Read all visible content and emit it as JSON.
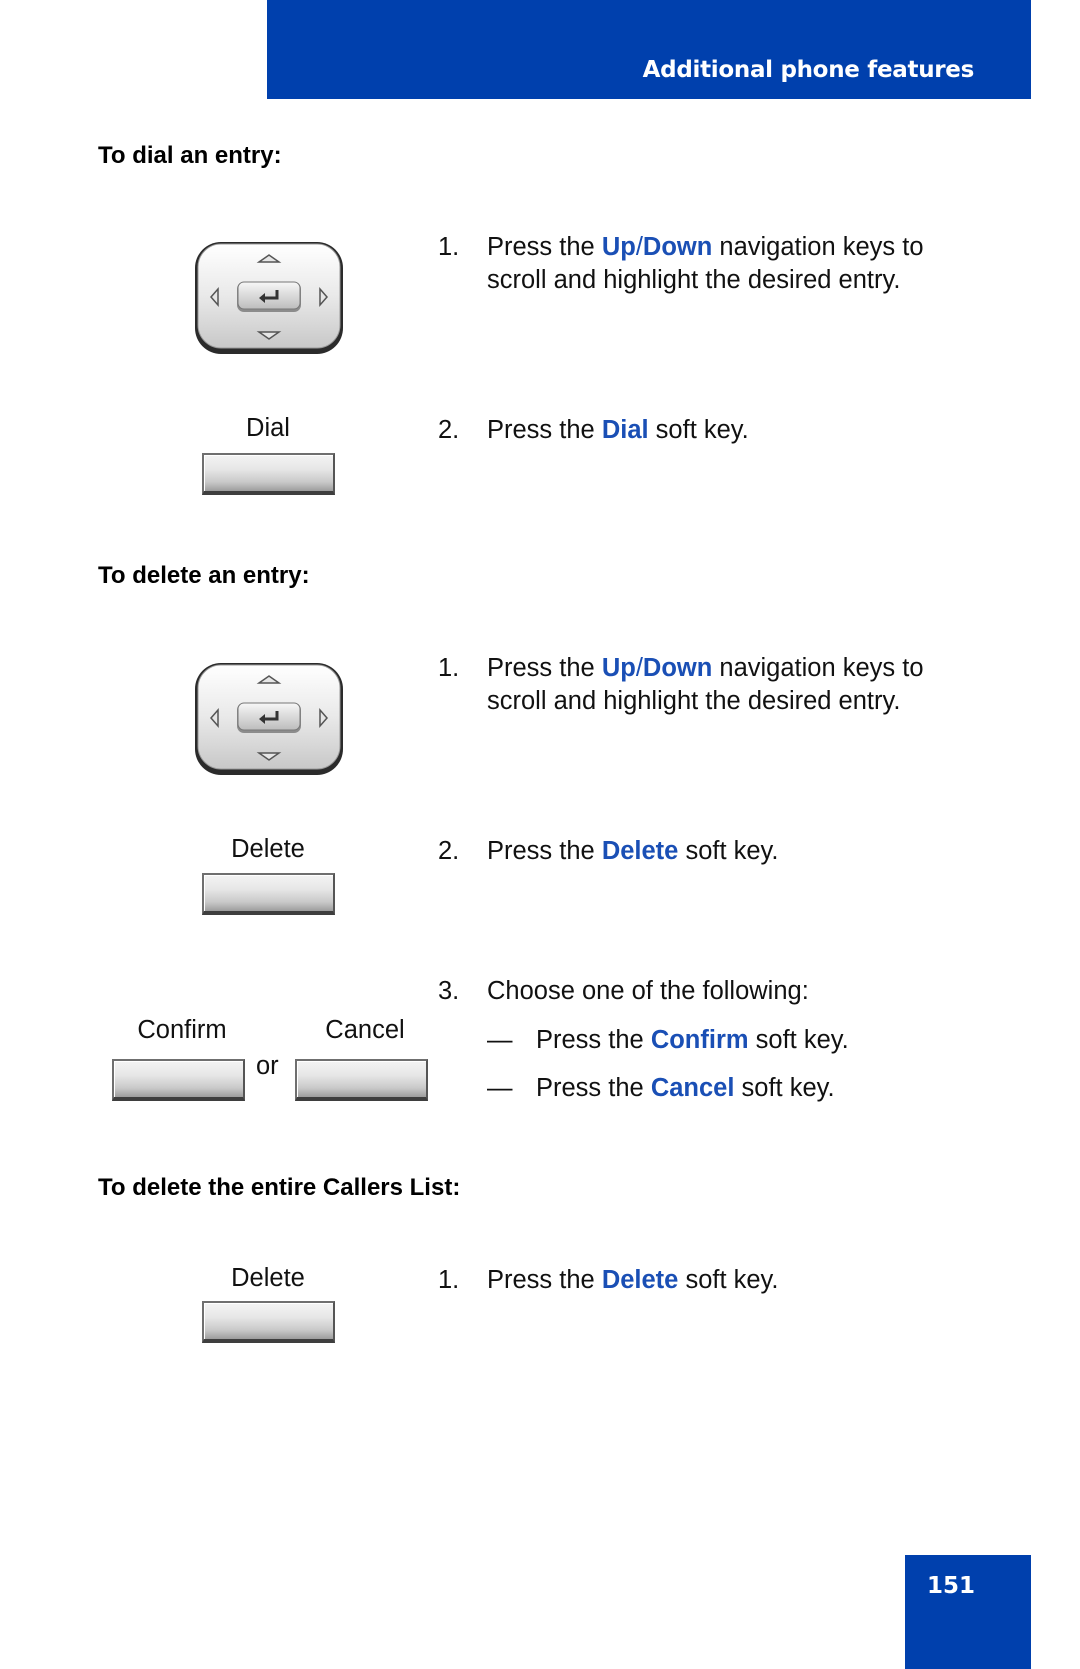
{
  "header": {
    "title": "Additional phone features"
  },
  "colors": {
    "brand_blue": "#0040ad",
    "keyword_blue": "#1a4fb5"
  },
  "sections": [
    {
      "heading": "To dial an entry:",
      "steps": [
        {
          "num": "1.",
          "pre": "Press the ",
          "kw1": "Up",
          "slash": "/",
          "kw2": "Down",
          "line1_post": " navigation keys to",
          "line2": "scroll and highlight the desired entry.",
          "image": "navigation-keys"
        },
        {
          "num": "2.",
          "pre": "Press the ",
          "kw": "Dial",
          "post": " soft key.",
          "softkey_label": "Dial"
        }
      ]
    },
    {
      "heading": "To delete an entry:",
      "steps": [
        {
          "num": "1.",
          "pre": "Press the ",
          "kw1": "Up",
          "slash": "/",
          "kw2": "Down",
          "line1_post": " navigation keys to",
          "line2": "scroll and highlight the desired entry.",
          "image": "navigation-keys"
        },
        {
          "num": "2.",
          "pre": "Press the ",
          "kw": "Delete",
          "post": " soft key.",
          "softkey_label": "Delete"
        },
        {
          "num": "3.",
          "text": "Choose one of the following:",
          "options": [
            {
              "bullet": "—",
              "pre": "Press the ",
              "kw": "Confirm",
              "post": " soft key."
            },
            {
              "bullet": "—",
              "pre": "Press the ",
              "kw": "Cancel",
              "post": " soft key."
            }
          ],
          "softkey_labels": [
            "Confirm",
            "Cancel"
          ],
          "or_text": "or"
        }
      ]
    },
    {
      "heading": "To delete the entire Callers List:",
      "steps": [
        {
          "num": "1.",
          "pre": "Press the ",
          "kw": "Delete",
          "post": " soft key.",
          "softkey_label": "Delete"
        }
      ]
    }
  ],
  "footer": {
    "page_number": "151"
  }
}
